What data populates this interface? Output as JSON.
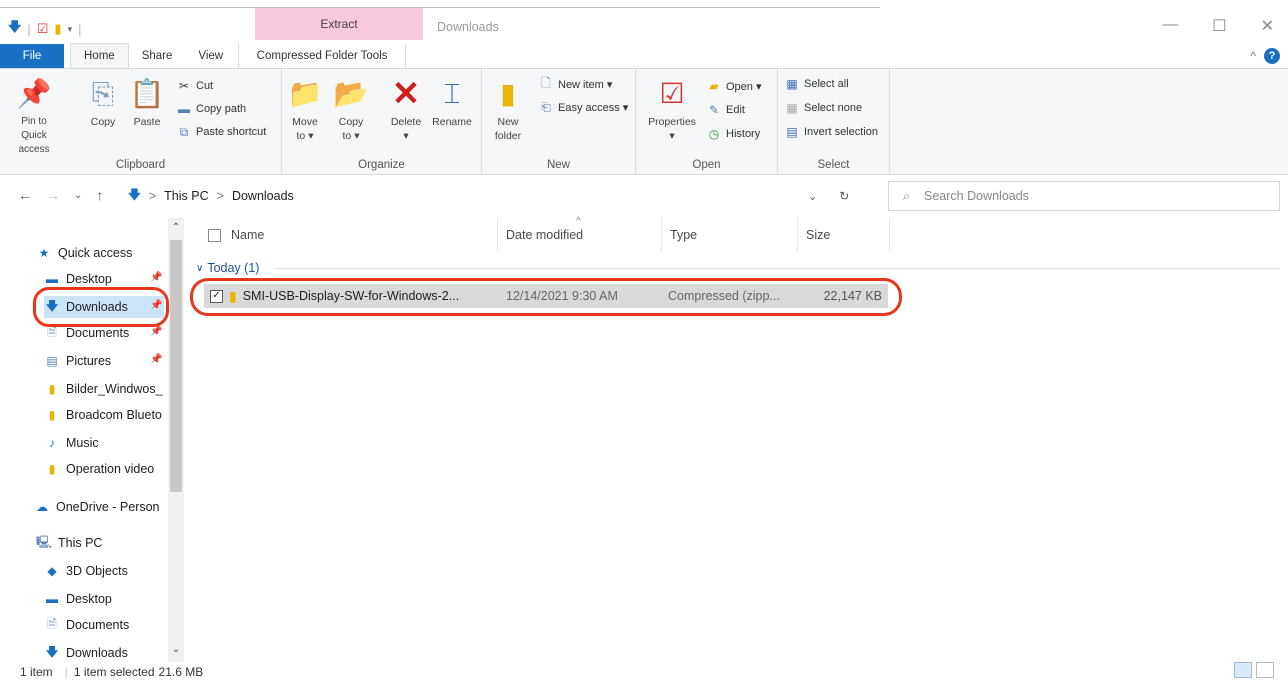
{
  "titlebar": {
    "context_tab": "Extract",
    "window_title": "Downloads",
    "minimize": "—",
    "maximize": "☐",
    "close": "✕"
  },
  "tabs": {
    "file": "File",
    "home": "Home",
    "share": "Share",
    "view": "View",
    "compressed": "Compressed Folder Tools"
  },
  "ribbon": {
    "clipboard": {
      "label": "Clipboard",
      "pin": "Pin to Quick access",
      "copy": "Copy",
      "paste": "Paste",
      "cut": "Cut",
      "copy_path": "Copy path",
      "paste_shortcut": "Paste shortcut"
    },
    "organize": {
      "label": "Organize",
      "move_to": "Move to ▾",
      "copy_to": "Copy to ▾",
      "delete": "Delete",
      "delete_arrow": "▾",
      "rename": "Rename"
    },
    "new": {
      "label": "New",
      "new_folder": "New folder",
      "new_item": "New item ▾",
      "easy_access": "Easy access ▾"
    },
    "open": {
      "label": "Open",
      "properties": "Properties",
      "properties_arrow": "▾",
      "open": "Open ▾",
      "edit": "Edit",
      "history": "History"
    },
    "select": {
      "label": "Select",
      "select_all": "Select all",
      "select_none": "Select none",
      "invert": "Invert selection"
    }
  },
  "address": {
    "this_pc": "This PC",
    "sep": ">",
    "folder": "Downloads",
    "search_placeholder": "Search Downloads"
  },
  "navpane": {
    "quick_access": "Quick access",
    "items": [
      {
        "label": "Desktop",
        "pinned": true
      },
      {
        "label": "Downloads",
        "pinned": true
      },
      {
        "label": "Documents",
        "pinned": true
      },
      {
        "label": "Pictures",
        "pinned": true
      },
      {
        "label": "Bilder_Windwos_",
        "pinned": false
      },
      {
        "label": "Broadcom Blueto",
        "pinned": false
      },
      {
        "label": "Music",
        "pinned": false
      },
      {
        "label": "Operation video",
        "pinned": false
      }
    ],
    "onedrive": "OneDrive - Person",
    "this_pc": "This PC",
    "pc_items": [
      "3D Objects",
      "Desktop",
      "Documents",
      "Downloads"
    ]
  },
  "columns": {
    "name": "Name",
    "date": "Date modified",
    "type": "Type",
    "size": "Size"
  },
  "group": {
    "label": "Today (1)"
  },
  "files": [
    {
      "name": "SMI-USB-Display-SW-for-Windows-2...",
      "date": "12/14/2021 9:30 AM",
      "type": "Compressed (zipp...",
      "size": "22,147 KB"
    }
  ],
  "status": {
    "count": "1 item",
    "selected": "1 item selected",
    "size": "21.6 MB"
  },
  "colors": {
    "accent": "#1a6fc4",
    "context_tab": "#f8c8dc",
    "highlight": "#e8361d"
  }
}
